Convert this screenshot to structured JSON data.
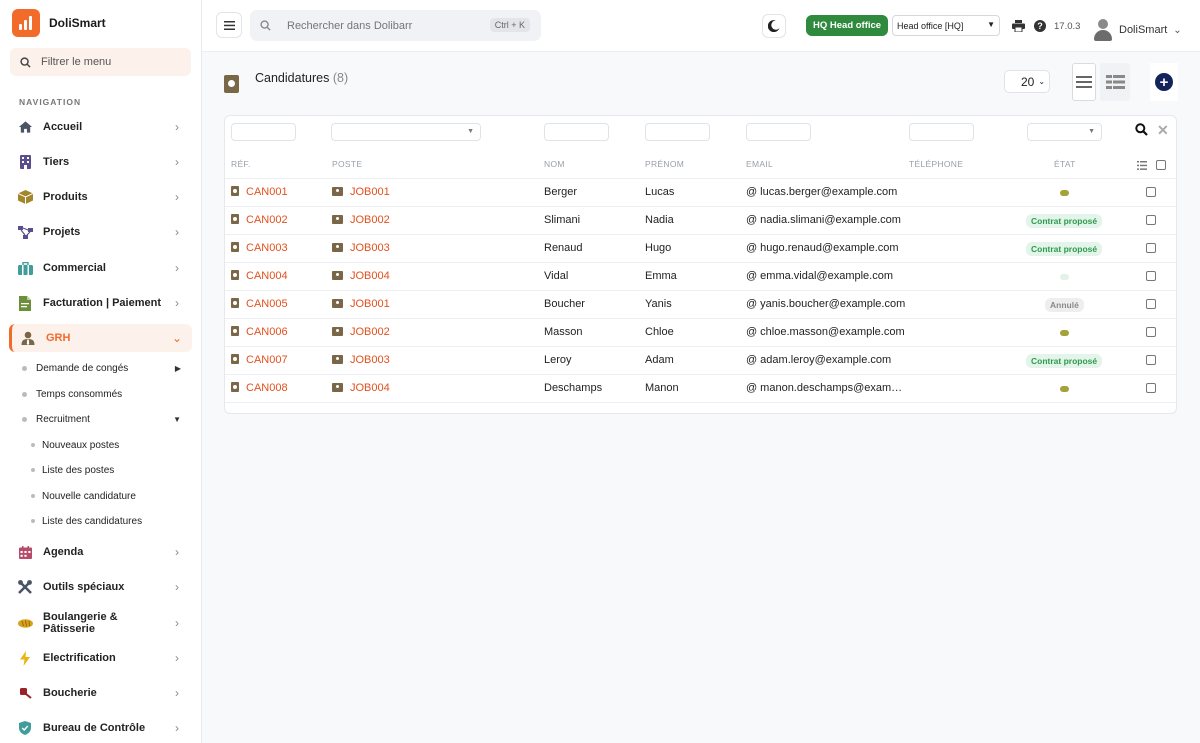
{
  "app": {
    "name": "DoliSmart"
  },
  "sidebar": {
    "filter_placeholder": "Filtrer le menu",
    "nav_title": "NAVIGATION",
    "items": [
      {
        "label": "Accueil",
        "icon": "home-icon"
      },
      {
        "label": "Tiers",
        "icon": "building-icon"
      },
      {
        "label": "Produits",
        "icon": "box-icon"
      },
      {
        "label": "Projets",
        "icon": "project-icon"
      },
      {
        "label": "Commercial",
        "icon": "suitcase-icon"
      },
      {
        "label": "Facturation | Paiement",
        "icon": "invoice-icon"
      },
      {
        "label": "GRH",
        "icon": "user-tie-icon",
        "active": true
      },
      {
        "label": "Agenda",
        "icon": "calendar-icon"
      },
      {
        "label": "Outils spéciaux",
        "icon": "tools-icon"
      },
      {
        "label": "Boulangerie & Pâtisserie",
        "icon": "bread-icon"
      },
      {
        "label": "Electrification",
        "icon": "lightning-icon"
      },
      {
        "label": "Boucherie",
        "icon": "meat-icon"
      },
      {
        "label": "Bureau de Contrôle",
        "icon": "shield-icon"
      }
    ],
    "grh_sub": [
      {
        "label": "Demande de congés"
      },
      {
        "label": "Temps consommés"
      },
      {
        "label": "Recruitment"
      }
    ],
    "recruitment_sub": [
      {
        "label": "Nouveaux postes"
      },
      {
        "label": "Liste des postes"
      },
      {
        "label": "Nouvelle candidature"
      },
      {
        "label": "Liste des candidatures"
      }
    ]
  },
  "topbar": {
    "search_placeholder": "Rechercher dans Dolibarr",
    "shortcut": "Ctrl + K",
    "hq_badge": "HQ Head office",
    "entity": "Head office [HQ]",
    "version": "17.0.3",
    "user": "DoliSmart"
  },
  "page": {
    "title": "Candidatures",
    "count": "(8)",
    "per_page": "20"
  },
  "table": {
    "headers": {
      "ref": "RÉF.",
      "poste": "POSTE",
      "nom": "NOM",
      "prenom": "PRÉNOM",
      "email": "EMAIL",
      "telephone": "TÉLÉPHONE",
      "etat": "ÉTAT"
    },
    "rows": [
      {
        "ref": "CAN001",
        "poste": "JOB001",
        "nom": "Berger",
        "prenom": "Lucas",
        "email": "lucas.berger@example.com",
        "etat": ""
      },
      {
        "ref": "CAN002",
        "poste": "JOB002",
        "nom": "Slimani",
        "prenom": "Nadia",
        "email": "nadia.slimani@example.com",
        "etat": "Contrat proposé"
      },
      {
        "ref": "CAN003",
        "poste": "JOB003",
        "nom": "Renaud",
        "prenom": "Hugo",
        "email": "hugo.renaud@example.com",
        "etat": "Contrat proposé"
      },
      {
        "ref": "CAN004",
        "poste": "JOB004",
        "nom": "Vidal",
        "prenom": "Emma",
        "email": "emma.vidal@example.com",
        "etat": ""
      },
      {
        "ref": "CAN005",
        "poste": "JOB001",
        "nom": "Boucher",
        "prenom": "Yanis",
        "email": "yanis.boucher@example.com",
        "etat": "Annulé"
      },
      {
        "ref": "CAN006",
        "poste": "JOB002",
        "nom": "Masson",
        "prenom": "Chloe",
        "email": "chloe.masson@example.com",
        "etat": ""
      },
      {
        "ref": "CAN007",
        "poste": "JOB003",
        "nom": "Leroy",
        "prenom": "Adam",
        "email": "adam.leroy@example.com",
        "etat": "Contrat proposé"
      },
      {
        "ref": "CAN008",
        "poste": "JOB004",
        "nom": "Deschamps",
        "prenom": "Manon",
        "email": "manon.deschamps@exam…",
        "etat": ""
      }
    ]
  },
  "colors": {
    "accent": "#f26b2b",
    "link": "#e3501d",
    "success": "#2f8a3e",
    "brand_dark": "#12245a"
  }
}
